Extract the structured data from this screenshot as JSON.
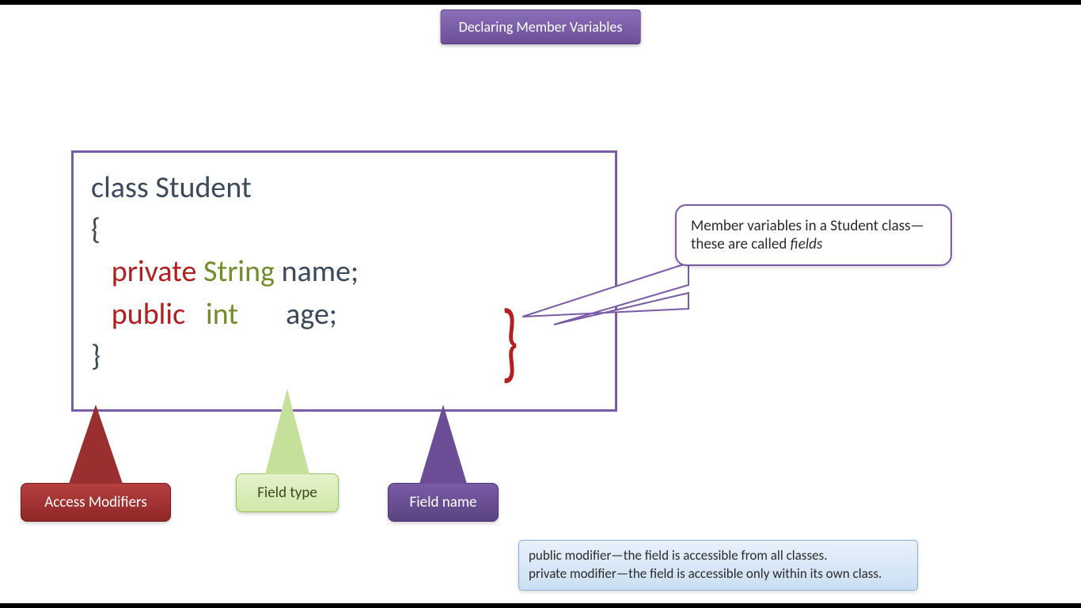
{
  "title": "Declaring Member Variables",
  "code": {
    "line1_class": "class ",
    "line1_name": "Student",
    "brace_open": "{",
    "brace_close": "}",
    "field1": {
      "modifier": "private",
      "type": "String",
      "name": "name;"
    },
    "field2": {
      "modifier": "public",
      "type": "int",
      "name": "age;"
    }
  },
  "callout": {
    "text_prefix": "Member variables in a Student class—these are called ",
    "text_italic": "fields"
  },
  "labels": {
    "access": "Access Modifiers",
    "type": "Field type",
    "name": "Field name"
  },
  "info": {
    "line1": "public modifier—the field is accessible from all classes.",
    "line2": "private modifier—the field is accessible only within its own class."
  },
  "colors": {
    "purple": "#7a5ba6",
    "red": "#b02020",
    "green": "#738d2c"
  }
}
